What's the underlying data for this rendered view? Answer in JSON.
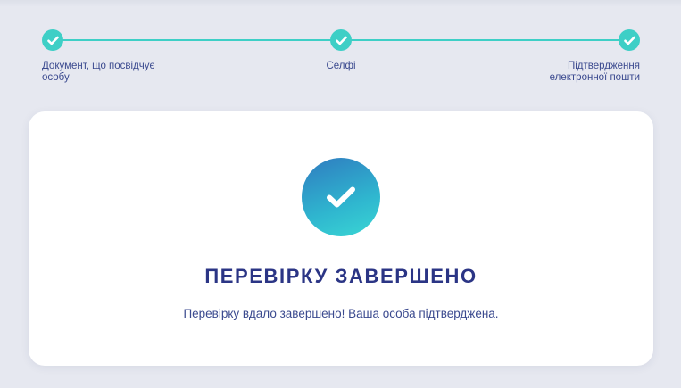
{
  "stepper": {
    "steps": [
      {
        "label": "Документ, що посвідчує особу",
        "state": "done"
      },
      {
        "label": "Селфі",
        "state": "done"
      },
      {
        "label": "Підтвердження електронної пошти",
        "state": "done"
      }
    ],
    "step_icon": "check-icon"
  },
  "result": {
    "icon": "check-icon",
    "title": "ПЕРЕВІРКУ ЗАВЕРШЕНО",
    "message": "Перевірку вдало завершено! Ваша особа підтверджена."
  },
  "colors": {
    "accent": "#3ecfc6",
    "title": "#2b3585",
    "text": "#3b4a8f",
    "background": "#e6e8f0",
    "card": "#ffffff"
  }
}
